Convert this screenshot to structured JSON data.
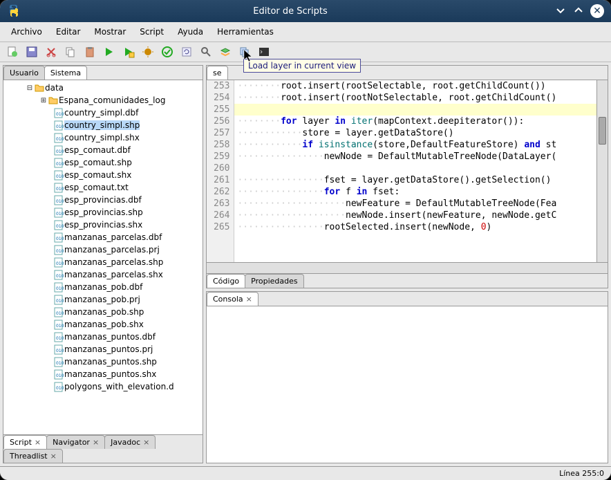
{
  "window": {
    "title": "Editor de Scripts"
  },
  "menu": {
    "items": [
      "Archivo",
      "Editar",
      "Mostrar",
      "Script",
      "Ayuda",
      "Herramientas"
    ]
  },
  "tooltip": "Load layer in current view",
  "leftTabs": {
    "user": "Usuario",
    "system": "Sistema"
  },
  "tree": {
    "root": "data",
    "folder": "Espana_comunidades_log",
    "files": [
      "country_simpl.dbf",
      "country_simpl.shp",
      "country_simpl.shx",
      "esp_comaut.dbf",
      "esp_comaut.shp",
      "esp_comaut.shx",
      "esp_comaut.txt",
      "esp_provincias.dbf",
      "esp_provincias.shp",
      "esp_provincias.shx",
      "manzanas_parcelas.dbf",
      "manzanas_parcelas.prj",
      "manzanas_parcelas.shp",
      "manzanas_parcelas.shx",
      "manzanas_pob.dbf",
      "manzanas_pob.prj",
      "manzanas_pob.shp",
      "manzanas_pob.shx",
      "manzanas_puntos.dbf",
      "manzanas_puntos.prj",
      "manzanas_puntos.shp",
      "manzanas_puntos.shx",
      "polygons_with_elevation.d"
    ],
    "selected": "country_simpl.shp"
  },
  "bottomTabs": [
    "Script",
    "Navigator",
    "Javadoc",
    "Threadlist"
  ],
  "editor": {
    "topTab": "se",
    "subTabs": [
      "Código",
      "Propiedades"
    ],
    "startLine": 253,
    "highlightLine": 255
  },
  "console": {
    "tab": "Consola"
  },
  "status": "Línea 255:0"
}
